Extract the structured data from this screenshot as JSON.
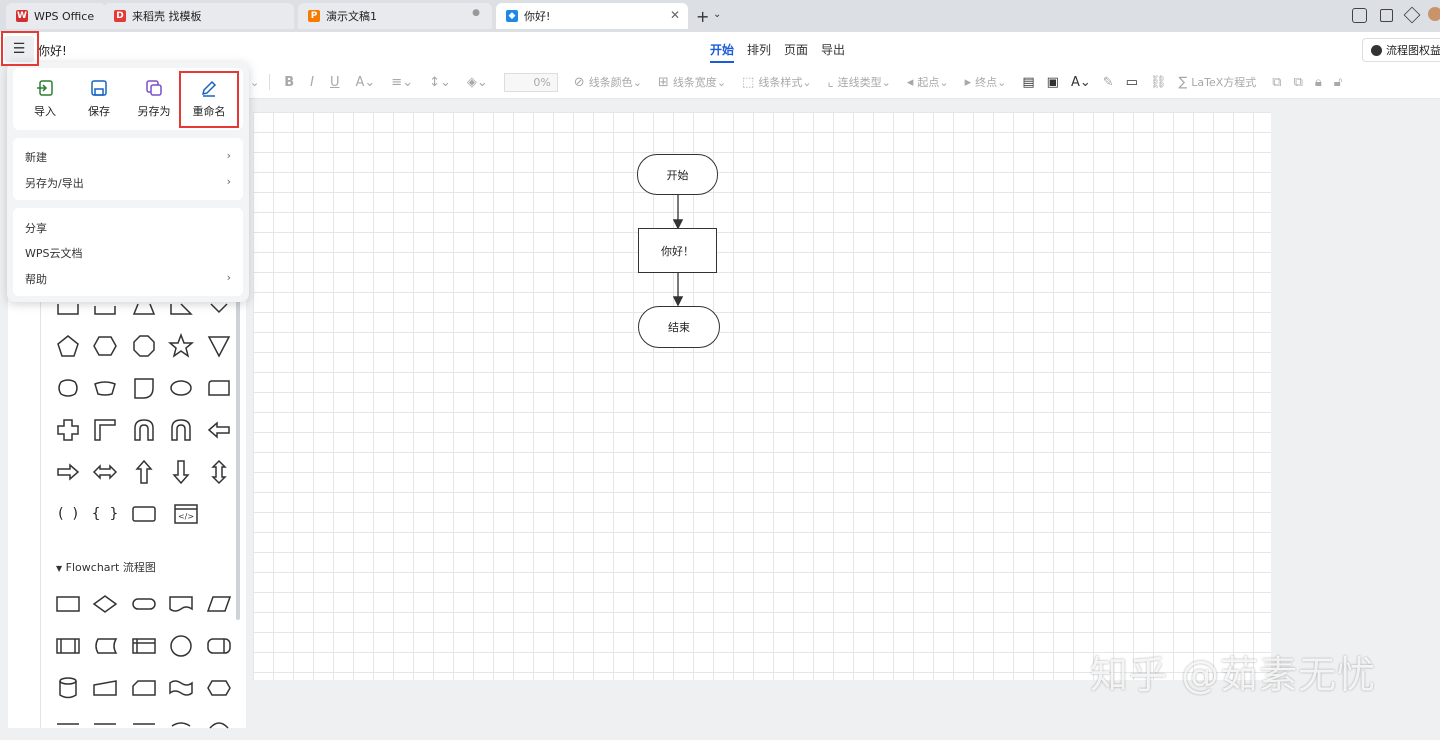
{
  "tabs": [
    {
      "label": "WPS Office",
      "icon": "wps-logo-icon",
      "color": "#d32f2f"
    },
    {
      "label": "来稻壳 找模板",
      "icon": "docer-icon",
      "color": "#e53935"
    },
    {
      "label": "演示文稿1",
      "icon": "presentation-icon",
      "color": "#f57c00"
    },
    {
      "label": "你好!",
      "icon": "flowchart-doc-icon",
      "color": "#1e88e5"
    }
  ],
  "header": {
    "doc_title": "你好!",
    "menu_tabs": [
      "开始",
      "排列",
      "页面",
      "导出"
    ],
    "active_tab": "开始",
    "benefit_button": "流程图权益"
  },
  "toolbar": {
    "opacity_value": "0%",
    "line_color": "线条颜色",
    "line_width": "线条宽度",
    "line_style": "线条样式",
    "connector_type": "连线类型",
    "start_point": "起点",
    "end_point": "终点",
    "latex": "LaTeX方程式"
  },
  "menu": {
    "quick_actions": [
      {
        "label": "导入",
        "icon": "import-icon"
      },
      {
        "label": "保存",
        "icon": "save-icon"
      },
      {
        "label": "另存为",
        "icon": "save-as-icon"
      },
      {
        "label": "重命名",
        "icon": "rename-pencil-icon"
      }
    ],
    "group1": [
      {
        "label": "新建",
        "has_submenu": true
      },
      {
        "label": "另存为/导出",
        "has_submenu": true
      }
    ],
    "group2": [
      {
        "label": "分享",
        "has_submenu": false
      },
      {
        "label": "WPS云文档",
        "has_submenu": false
      },
      {
        "label": "帮助",
        "has_submenu": true
      }
    ]
  },
  "shapes_panel": {
    "flowchart_section": "Flowchart 流程图"
  },
  "flowchart": {
    "start": "开始",
    "process": "你好！",
    "end": "结束"
  },
  "watermark": "知乎 @茹素无忧",
  "colors": {
    "accent": "#1a5cdb",
    "highlight_box": "#e53935"
  }
}
